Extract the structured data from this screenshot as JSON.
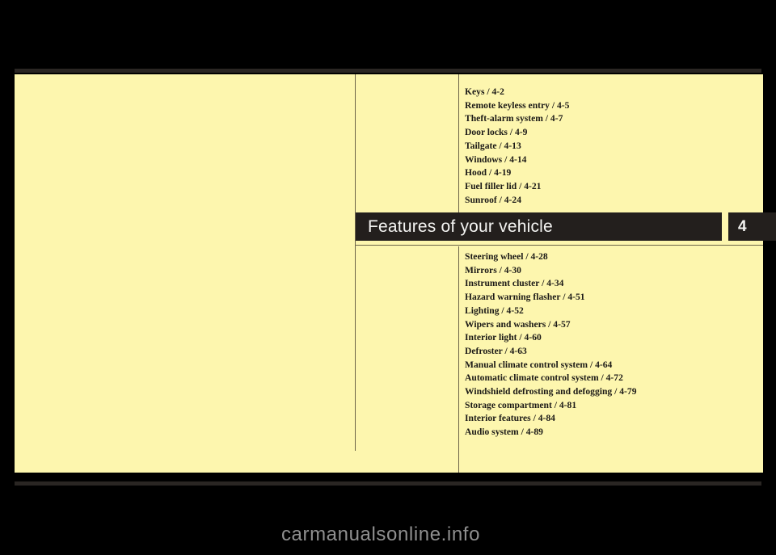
{
  "page": {
    "background_color": "#000000",
    "sheet_color": "#fdf6ae",
    "rule_color": "#2a2623",
    "hairline_color": "#6c6448"
  },
  "banner": {
    "title": "Features of your vehicle",
    "chapter_number": "4",
    "background_color": "#231f1d",
    "text_color": "#f4f4f2"
  },
  "toc": {
    "upper_items": [
      "Keys / 4-2",
      "Remote keyless entry / 4-5",
      "Theft-alarm system / 4-7",
      "Door locks / 4-9",
      "Tailgate / 4-13",
      "Windows / 4-14",
      "Hood / 4-19",
      "Fuel filler lid / 4-21",
      "Sunroof / 4-24"
    ],
    "lower_items": [
      "Steering wheel / 4-28",
      "Mirrors / 4-30",
      "Instrument cluster / 4-34",
      "Hazard warning flasher / 4-51",
      "Lighting / 4-52",
      "Wipers and washers / 4-57",
      "Interior light / 4-60",
      "Defroster / 4-63",
      "Manual climate control system / 4-64",
      "Automatic climate control system / 4-72",
      "Windshield defrosting and defogging / 4-79",
      "Storage compartment / 4-81",
      "Interior features / 4-84",
      "Audio system / 4-89"
    ]
  },
  "watermark": {
    "text": "carmanualsonline.info",
    "color": "#8f8f8f"
  }
}
